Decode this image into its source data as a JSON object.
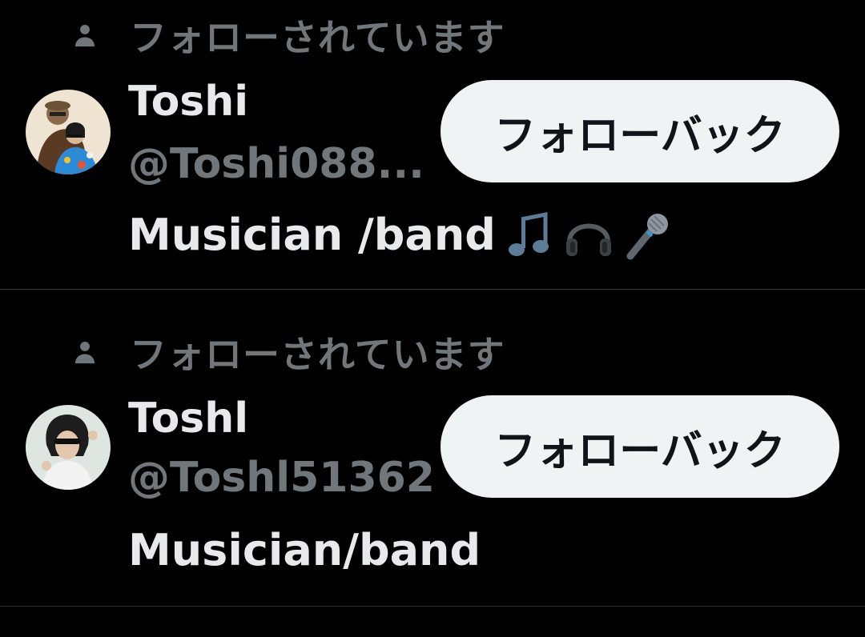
{
  "follow_list": {
    "context_label": "フォローされています",
    "follow_back_label": "フォローバック",
    "users": [
      {
        "display_name": "Toshi",
        "handle": "@Toshi088...",
        "bio": "Musician /band",
        "bio_emojis": [
          "musical-notes-icon",
          "headphones-icon",
          "microphone-icon"
        ]
      },
      {
        "display_name": "Toshl",
        "handle": "@Toshl51362",
        "bio": "Musician/band",
        "bio_emojis": []
      }
    ]
  },
  "colors": {
    "background": "#000000",
    "primary_text": "#e7e9ea",
    "secondary_text": "#71767b",
    "button_bg": "#eff3f4",
    "button_text": "#0f1419",
    "divider": "#2f3336"
  }
}
